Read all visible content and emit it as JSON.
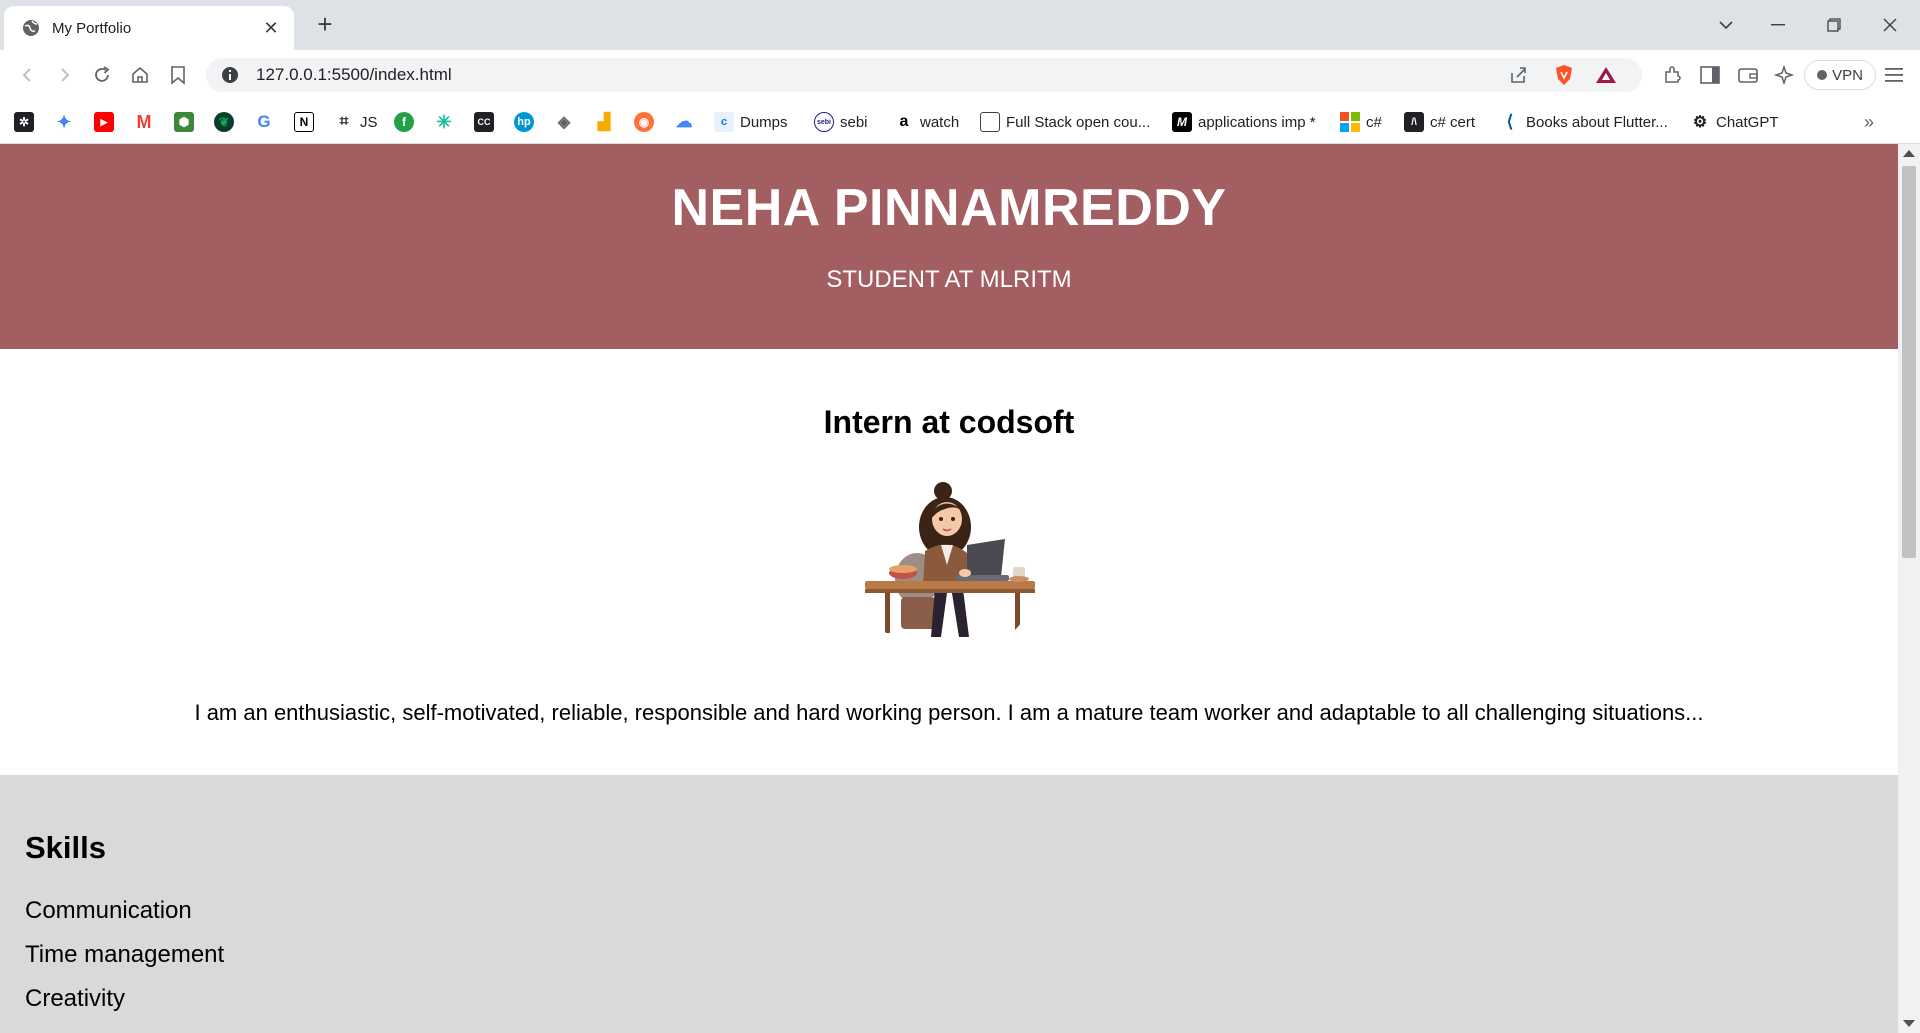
{
  "browser": {
    "tab_title": "My Portfolio",
    "url": "127.0.0.1:5500/index.html",
    "vpn_label": "VPN"
  },
  "bookmarks": [
    {
      "label": "",
      "icon": "app-icon"
    },
    {
      "label": "",
      "icon": "gemini-icon"
    },
    {
      "label": "",
      "icon": "youtube-icon"
    },
    {
      "label": "",
      "icon": "gmail-icon"
    },
    {
      "label": "",
      "icon": "node-icon"
    },
    {
      "label": "",
      "icon": "mongodb-icon"
    },
    {
      "label": "",
      "icon": "google-icon"
    },
    {
      "label": "",
      "icon": "notion-icon"
    },
    {
      "label": "JS",
      "icon": "js-icon"
    },
    {
      "label": "",
      "icon": "freecodecamp-icon"
    },
    {
      "label": "",
      "icon": "asterisk-icon"
    },
    {
      "label": "",
      "icon": "cc-icon"
    },
    {
      "label": "",
      "icon": "hp-icon"
    },
    {
      "label": "",
      "icon": "cap-icon"
    },
    {
      "label": "",
      "icon": "analytics-icon"
    },
    {
      "label": "",
      "icon": "firefox-icon"
    },
    {
      "label": "",
      "icon": "cloud-icon"
    },
    {
      "label": "Dumps",
      "icon": "dumps-icon"
    },
    {
      "label": "sebi",
      "icon": "sebi-icon"
    },
    {
      "label": "watch",
      "icon": "amazon-icon"
    },
    {
      "label": "Full Stack open cou...",
      "icon": "page-icon"
    },
    {
      "label": "applications imp *",
      "icon": "m-icon"
    },
    {
      "label": "c#",
      "icon": "microsoft-icon"
    },
    {
      "label": "c# cert",
      "icon": "cert-icon"
    },
    {
      "label": "Books about Flutter...",
      "icon": "flutter-icon"
    },
    {
      "label": "ChatGPT",
      "icon": "chatgpt-icon"
    }
  ],
  "hero": {
    "name": "NEHA PINNAMREDDY",
    "subtitle": "STUDENT AT MLRITM"
  },
  "about": {
    "title": "Intern at codsoft",
    "text": "I am an enthusiastic, self-motivated, reliable, responsible and hard working person. I am a mature team worker and adaptable to all challenging situations..."
  },
  "skills": {
    "title": "Skills",
    "items": [
      "Communication",
      "Time management",
      "Creativity"
    ]
  },
  "colors": {
    "hero_bg": "#a35e62",
    "skills_bg": "#d9d9d9",
    "tabstrip_bg": "#dee1e6"
  }
}
